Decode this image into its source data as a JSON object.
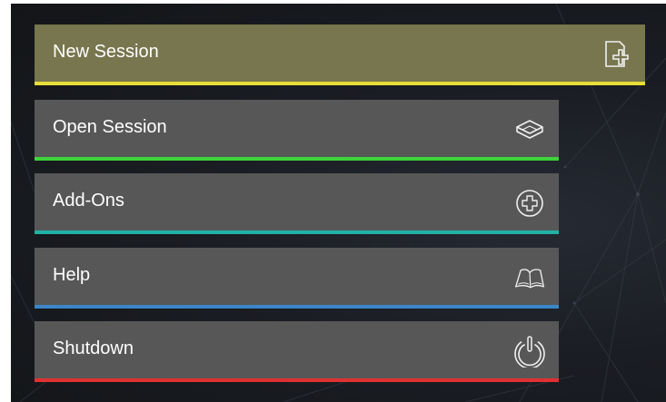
{
  "menu": {
    "items": [
      {
        "label": "New Session",
        "icon": "new-session-icon",
        "accent": "#e8de3a",
        "active": true
      },
      {
        "label": "Open Session",
        "icon": "open-layers-icon",
        "accent": "#3dd43a",
        "active": false
      },
      {
        "label": "Add-Ons",
        "icon": "plus-circle-icon",
        "accent": "#1fb3a6",
        "active": false
      },
      {
        "label": "Help",
        "icon": "book-icon",
        "accent": "#3a86c8",
        "active": false
      },
      {
        "label": "Shutdown",
        "icon": "power-icon",
        "accent": "#e03131",
        "active": false
      }
    ]
  },
  "colors": {
    "background": "#1a1d23",
    "item_background": "#575757",
    "active_item_background": "#77764e",
    "text": "#ffffff"
  }
}
